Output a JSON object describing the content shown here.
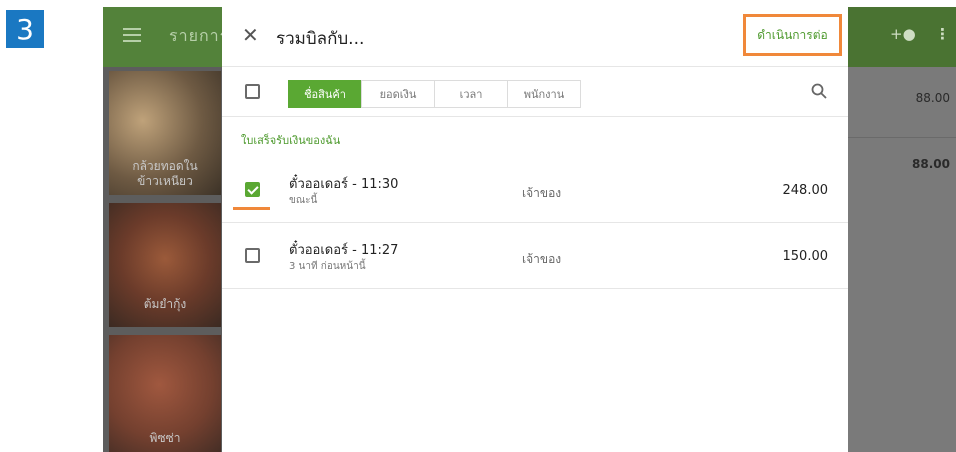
{
  "step": {
    "number": "3"
  },
  "background_app": {
    "title": "รายการ",
    "tiles": [
      {
        "label": "กล้วยทอดใน\nข้าวเหนียว"
      },
      {
        "label": "ต้มยำกุ้ง"
      },
      {
        "label": "พิซซ่า"
      }
    ],
    "totals": [
      "88.00",
      "88.00"
    ],
    "icons": [
      "menu-icon",
      "add-person-icon",
      "more-vert-icon"
    ]
  },
  "dialog": {
    "title": "รวมบิลกับ...",
    "close_icon": "close-icon",
    "continue_label": "ดำเนินการต่อ",
    "tabs": [
      {
        "label": "ชื่อสินค้า",
        "active": true
      },
      {
        "label": "ยอดเงิน",
        "active": false
      },
      {
        "label": "เวลา",
        "active": false
      },
      {
        "label": "พนักงาน",
        "active": false
      }
    ],
    "search_icon": "search-icon",
    "section_label": "ใบเสร็จรับเงินของฉัน",
    "receipts": [
      {
        "title": "ตั๋วออเดอร์ - 11:30",
        "subtitle": "ขณะนี้",
        "owner": "เจ้าของ",
        "amount": "248.00",
        "checked": true
      },
      {
        "title": "ตั๋วออเดอร์ - 11:27",
        "subtitle": "3 นาที ก่อนหน้านี้",
        "owner": "เจ้าของ",
        "amount": "150.00",
        "checked": false
      }
    ]
  },
  "colors": {
    "accent_green": "#5aa833",
    "highlight_orange": "#f0883a",
    "step_blue": "#1a78c2"
  }
}
